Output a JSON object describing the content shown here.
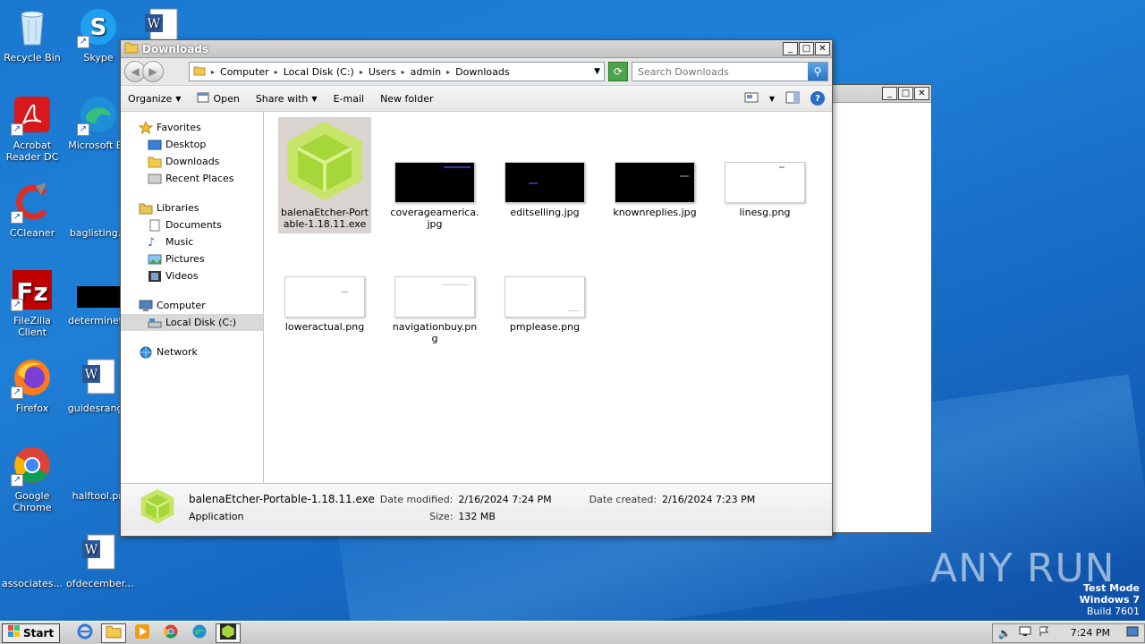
{
  "desktop": {
    "icons": [
      {
        "label": "Recycle Bin"
      },
      {
        "label": "Skype"
      },
      {
        "label": "Acrobat Reader DC"
      },
      {
        "label": "Microsoft Ed"
      },
      {
        "label": "CCleaner"
      },
      {
        "label": "baglisting.p"
      },
      {
        "label": "FileZilla Client"
      },
      {
        "label": "determineth"
      },
      {
        "label": "Firefox"
      },
      {
        "label": "guidesrange"
      },
      {
        "label": "Google Chrome"
      },
      {
        "label": "halftool.pn"
      },
      {
        "label": "associates..."
      },
      {
        "label": "ofdecember..."
      }
    ]
  },
  "explorer": {
    "title": "Downloads",
    "address": [
      "Computer",
      "Local Disk (C:)",
      "Users",
      "admin",
      "Downloads"
    ],
    "search_placeholder": "Search Downloads",
    "toolbar": {
      "organize": "Organize",
      "open": "Open",
      "share_with": "Share with",
      "email": "E-mail",
      "new_folder": "New folder"
    },
    "nav": {
      "favorites": "Favorites",
      "desktop": "Desktop",
      "downloads": "Downloads",
      "recent_places": "Recent Places",
      "libraries": "Libraries",
      "documents": "Documents",
      "music": "Music",
      "pictures": "Pictures",
      "videos": "Videos",
      "computer": "Computer",
      "local_disk": "Local Disk (C:)",
      "network": "Network"
    },
    "files": [
      {
        "name": "balenaEtcher-Portable-1.18.11.exe"
      },
      {
        "name": "coverageamerica.jpg"
      },
      {
        "name": "editselling.jpg"
      },
      {
        "name": "knownreplies.jpg"
      },
      {
        "name": "linesg.png"
      },
      {
        "name": "loweractual.png"
      },
      {
        "name": "navigationbuy.png"
      },
      {
        "name": "pmplease.png"
      }
    ],
    "details": {
      "name": "balenaEtcher-Portable-1.18.11.exe",
      "type": "Application",
      "modified_label": "Date modified:",
      "modified_value": "2/16/2024 7:24 PM",
      "size_label": "Size:",
      "size_value": "132 MB",
      "created_label": "Date created:",
      "created_value": "2/16/2024 7:23 PM"
    }
  },
  "taskbar": {
    "start": "Start",
    "clock": "7:24 PM"
  },
  "watermark": {
    "line1": "Test Mode",
    "line2": "Windows 7",
    "line3": "Build 7601"
  },
  "brand": "ANY RUN"
}
